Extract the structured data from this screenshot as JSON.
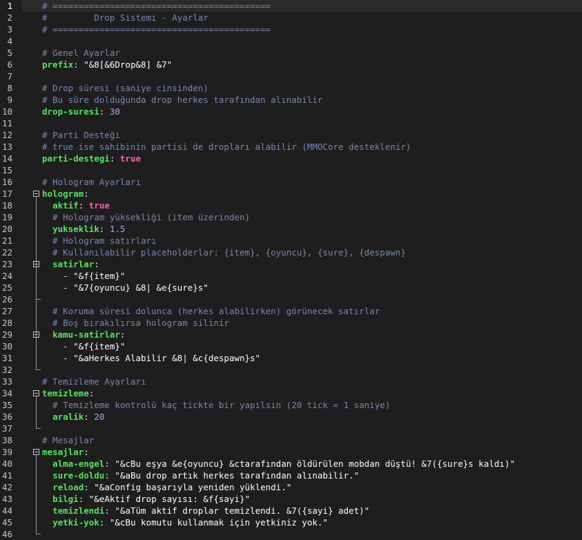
{
  "editor": {
    "lines": [
      {
        "n": "1",
        "tokens": [
          {
            "t": "# ==========================================",
            "c": "c"
          }
        ]
      },
      {
        "n": "2",
        "tokens": [
          {
            "t": "#         Drop Sistemi - Ayarlar",
            "c": "c"
          }
        ]
      },
      {
        "n": "3",
        "tokens": [
          {
            "t": "# ==========================================",
            "c": "c"
          }
        ]
      },
      {
        "n": "4",
        "tokens": []
      },
      {
        "n": "5",
        "tokens": [
          {
            "t": "# Genel Ayarlar",
            "c": "c"
          }
        ]
      },
      {
        "n": "6",
        "tokens": [
          {
            "t": "prefix",
            "c": "k"
          },
          {
            "t": ": ",
            "c": "p"
          },
          {
            "t": "\"&8[&6Drop&8] &7\"",
            "c": "s"
          }
        ]
      },
      {
        "n": "7",
        "tokens": []
      },
      {
        "n": "8",
        "tokens": [
          {
            "t": "# Drop süresi (saniye cinsinden)",
            "c": "c"
          }
        ]
      },
      {
        "n": "9",
        "tokens": [
          {
            "t": "# Bu süre dolduğunda drop herkes tarafından alınabilir",
            "c": "c"
          }
        ]
      },
      {
        "n": "10",
        "tokens": [
          {
            "t": "drop-suresi",
            "c": "k"
          },
          {
            "t": ": ",
            "c": "p"
          },
          {
            "t": "30",
            "c": "n"
          }
        ]
      },
      {
        "n": "11",
        "tokens": []
      },
      {
        "n": "12",
        "tokens": [
          {
            "t": "# Parti Desteği",
            "c": "c"
          }
        ]
      },
      {
        "n": "13",
        "tokens": [
          {
            "t": "# true ise sahibinin partisi de dropları alabilir (MMOCore desteklenir)",
            "c": "c"
          }
        ]
      },
      {
        "n": "14",
        "tokens": [
          {
            "t": "parti-destegi",
            "c": "k"
          },
          {
            "t": ": ",
            "c": "p"
          },
          {
            "t": "true",
            "c": "b"
          }
        ]
      },
      {
        "n": "15",
        "tokens": []
      },
      {
        "n": "16",
        "tokens": [
          {
            "t": "# Hologram Ayarları",
            "c": "c"
          }
        ]
      },
      {
        "n": "17",
        "tokens": [
          {
            "t": "hologram",
            "c": "k"
          },
          {
            "t": ":",
            "c": "p"
          }
        ]
      },
      {
        "n": "18",
        "tokens": [
          {
            "t": "  ",
            "c": "p"
          },
          {
            "t": "aktif",
            "c": "k"
          },
          {
            "t": ": ",
            "c": "p"
          },
          {
            "t": "true",
            "c": "b"
          }
        ]
      },
      {
        "n": "19",
        "tokens": [
          {
            "t": "  # Hologram yüksekliği (item üzerinden)",
            "c": "c"
          }
        ]
      },
      {
        "n": "20",
        "tokens": [
          {
            "t": "  ",
            "c": "p"
          },
          {
            "t": "yukseklik",
            "c": "k"
          },
          {
            "t": ": ",
            "c": "p"
          },
          {
            "t": "1.5",
            "c": "n"
          }
        ]
      },
      {
        "n": "21",
        "tokens": [
          {
            "t": "  # Hologram satırları",
            "c": "c"
          }
        ]
      },
      {
        "n": "22",
        "tokens": [
          {
            "t": "  # Kullanılabilir placeholderlar: {item}, {oyuncu}, {sure}, {despawn}",
            "c": "c"
          }
        ]
      },
      {
        "n": "23",
        "tokens": [
          {
            "t": "  ",
            "c": "p"
          },
          {
            "t": "satirlar",
            "c": "k"
          },
          {
            "t": ":",
            "c": "p"
          }
        ]
      },
      {
        "n": "24",
        "tokens": [
          {
            "t": "    - ",
            "c": "p"
          },
          {
            "t": "\"&f{item}\"",
            "c": "s"
          }
        ]
      },
      {
        "n": "25",
        "tokens": [
          {
            "t": "    - ",
            "c": "p"
          },
          {
            "t": "\"&7{oyuncu} &8| &e{sure}s\"",
            "c": "s"
          }
        ]
      },
      {
        "n": "26",
        "tokens": []
      },
      {
        "n": "27",
        "tokens": [
          {
            "t": "  # Koruma süresi dolunca (herkes alabilirken) görünecek satırlar",
            "c": "c"
          }
        ]
      },
      {
        "n": "28",
        "tokens": [
          {
            "t": "  # Boş bırakılırsa hologram silinir",
            "c": "c"
          }
        ]
      },
      {
        "n": "29",
        "tokens": [
          {
            "t": "  ",
            "c": "p"
          },
          {
            "t": "kamu-satirlar",
            "c": "k"
          },
          {
            "t": ":",
            "c": "p"
          }
        ]
      },
      {
        "n": "30",
        "tokens": [
          {
            "t": "    - ",
            "c": "p"
          },
          {
            "t": "\"&f{item}\"",
            "c": "s"
          }
        ]
      },
      {
        "n": "31",
        "tokens": [
          {
            "t": "    - ",
            "c": "p"
          },
          {
            "t": "\"&aHerkes Alabilir &8| &c{despawn}s\"",
            "c": "s"
          }
        ]
      },
      {
        "n": "32",
        "tokens": []
      },
      {
        "n": "33",
        "tokens": [
          {
            "t": "# Temizleme Ayarları",
            "c": "c"
          }
        ]
      },
      {
        "n": "34",
        "tokens": [
          {
            "t": "temizleme",
            "c": "k"
          },
          {
            "t": ":",
            "c": "p"
          }
        ]
      },
      {
        "n": "35",
        "tokens": [
          {
            "t": "  # Temizleme kontrolü kaç tickte bir yapılsın (20 tick = 1 saniye)",
            "c": "c"
          }
        ]
      },
      {
        "n": "36",
        "tokens": [
          {
            "t": "  ",
            "c": "p"
          },
          {
            "t": "aralik",
            "c": "k"
          },
          {
            "t": ": ",
            "c": "p"
          },
          {
            "t": "20",
            "c": "n"
          }
        ]
      },
      {
        "n": "37",
        "tokens": []
      },
      {
        "n": "38",
        "tokens": [
          {
            "t": "# Mesajlar",
            "c": "c"
          }
        ]
      },
      {
        "n": "39",
        "tokens": [
          {
            "t": "mesajlar",
            "c": "k"
          },
          {
            "t": ":",
            "c": "p"
          }
        ]
      },
      {
        "n": "40",
        "tokens": [
          {
            "t": "  ",
            "c": "p"
          },
          {
            "t": "alma-engel",
            "c": "k"
          },
          {
            "t": ": ",
            "c": "p"
          },
          {
            "t": "\"&cBu eşya &e{oyuncu} &ctarafından öldürülen mobdan düştü! &7({sure}s kaldı)\"",
            "c": "s"
          }
        ]
      },
      {
        "n": "41",
        "tokens": [
          {
            "t": "  ",
            "c": "p"
          },
          {
            "t": "sure-doldu",
            "c": "k"
          },
          {
            "t": ": ",
            "c": "p"
          },
          {
            "t": "\"&aBu drop artık herkes tarafından alınabilir.\"",
            "c": "s"
          }
        ]
      },
      {
        "n": "42",
        "tokens": [
          {
            "t": "  ",
            "c": "p"
          },
          {
            "t": "reload",
            "c": "k"
          },
          {
            "t": ": ",
            "c": "p"
          },
          {
            "t": "\"&aConfig başarıyla yeniden yüklendi.\"",
            "c": "s"
          }
        ]
      },
      {
        "n": "43",
        "tokens": [
          {
            "t": "  ",
            "c": "p"
          },
          {
            "t": "bilgi",
            "c": "k"
          },
          {
            "t": ": ",
            "c": "p"
          },
          {
            "t": "\"&eAktif drop sayısı: &f{sayi}\"",
            "c": "s"
          }
        ]
      },
      {
        "n": "44",
        "tokens": [
          {
            "t": "  ",
            "c": "p"
          },
          {
            "t": "temizlendi",
            "c": "k"
          },
          {
            "t": ": ",
            "c": "p"
          },
          {
            "t": "\"&aTüm aktif droplar temizlendi. &7({sayi} adet)\"",
            "c": "s"
          }
        ]
      },
      {
        "n": "45",
        "tokens": [
          {
            "t": "  ",
            "c": "p"
          },
          {
            "t": "yetki-yok",
            "c": "k"
          },
          {
            "t": ": ",
            "c": "p"
          },
          {
            "t": "\"&cBu komutu kullanmak için yetkiniz yok.\"",
            "c": "s"
          }
        ]
      },
      {
        "n": "46",
        "tokens": []
      }
    ]
  },
  "colors": {
    "background": "#1e1e1e",
    "comment": "#7a86b3",
    "key": "#56e35e",
    "string": "#ffffff",
    "number": "#c79af2",
    "boolean": "#ff5fb0"
  }
}
